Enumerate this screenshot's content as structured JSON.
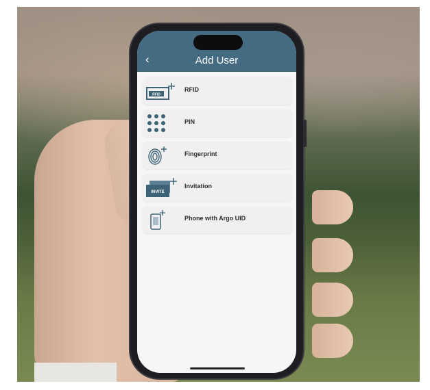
{
  "header": {
    "back_icon": "chevron-left-icon",
    "title": "Add User"
  },
  "colors": {
    "header": "#456b82",
    "icon": "#3e6276",
    "screen_bg": "#f6f6f6"
  },
  "items": [
    {
      "label": "RFID",
      "icon": "rfid-card-icon",
      "icon_text": "RFID"
    },
    {
      "label": "PIN",
      "icon": "pin-keypad-icon"
    },
    {
      "label": "Fingerprint",
      "icon": "fingerprint-icon"
    },
    {
      "label": "Invitation",
      "icon": "invitation-card-icon",
      "icon_text": "INVITE"
    },
    {
      "label": "Phone with Argo UID",
      "icon": "phone-icon"
    }
  ]
}
